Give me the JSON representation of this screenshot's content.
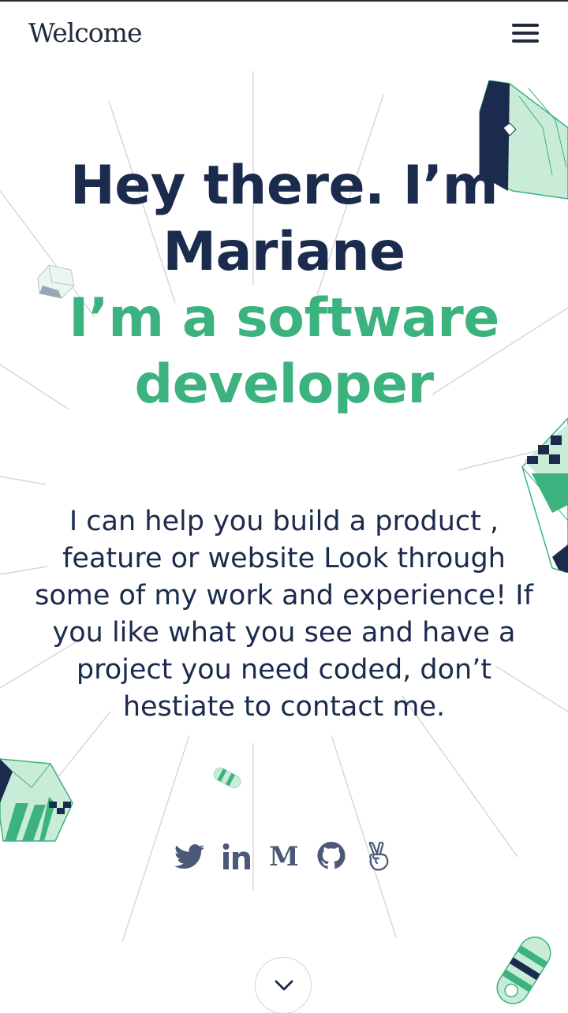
{
  "header": {
    "brand": "Welcome",
    "menu_icon": "hamburger-menu-icon"
  },
  "hero": {
    "intro_line_1": "Hey there. I’m",
    "intro_line_2": "Mariane",
    "role_line_1": "I’m a software",
    "role_line_2": "developer"
  },
  "bio": {
    "text": "I can help you build a product , feature or website Look through some of my work and experience! If you like what you see and have a project you need coded, don’t hestiate to contact me."
  },
  "social": [
    {
      "name": "twitter",
      "icon": "twitter-icon"
    },
    {
      "name": "linkedin",
      "icon": "linkedin-icon",
      "glyph": "in"
    },
    {
      "name": "medium",
      "icon": "medium-icon",
      "glyph": "M"
    },
    {
      "name": "github",
      "icon": "github-icon"
    },
    {
      "name": "angellist",
      "icon": "angellist-icon"
    }
  ],
  "scroll": {
    "icon": "chevron-down-icon"
  },
  "colors": {
    "navy": "#1a2b4d",
    "green": "#3cb27e",
    "mint": "#c9ecd9",
    "icon_gray": "#4a5975",
    "ray": "#c8c8c8"
  }
}
